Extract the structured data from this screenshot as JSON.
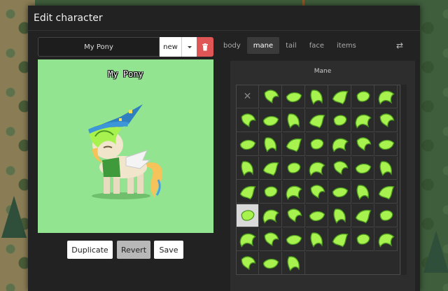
{
  "modal": {
    "title": "Edit character"
  },
  "name_field": {
    "value": "My Pony"
  },
  "preset": {
    "selected": "new"
  },
  "preview": {
    "pony_name": "My Pony"
  },
  "actions": {
    "duplicate": "Duplicate",
    "revert": "Revert",
    "save": "Save"
  },
  "tabs": [
    {
      "label": "body",
      "active": false
    },
    {
      "label": "mane",
      "active": true
    },
    {
      "label": "tail",
      "active": false
    },
    {
      "label": "face",
      "active": false
    },
    {
      "label": "items",
      "active": false
    }
  ],
  "panel": {
    "title": "Mane"
  },
  "colors": {
    "preview_bg": "#93e491",
    "hair_light": "#a8f24f",
    "hair_dark": "#4d9a1f",
    "delete_red": "#e05555"
  },
  "grid": {
    "columns": 7,
    "rows": 8,
    "last_row_items": 3,
    "selected_index": 35
  }
}
